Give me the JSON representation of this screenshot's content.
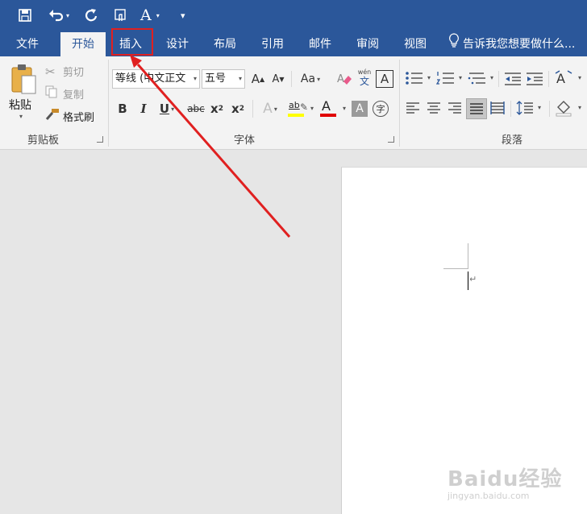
{
  "quick_access": {
    "save_icon": "save-icon",
    "undo_icon": "undo-icon",
    "redo_icon": "redo-icon",
    "touch_icon": "touch-mode-icon",
    "font_icon_label": "A",
    "customize_icon": "customize-qat-icon"
  },
  "tabs": {
    "file": "文件",
    "home": "开始",
    "insert": "插入",
    "design": "设计",
    "layout": "布局",
    "references": "引用",
    "mailings": "邮件",
    "review": "审阅",
    "view": "视图",
    "tell_me": "告诉我您想要做什么..."
  },
  "clipboard": {
    "paste": "粘贴",
    "cut": "剪切",
    "copy": "复制",
    "format_painter": "格式刷",
    "group_label": "剪贴板"
  },
  "font": {
    "font_name": "等线 (中文正文",
    "font_size": "五号",
    "grow": "A",
    "shrink": "A",
    "change_case": "Aa",
    "phonetic_top": "wén",
    "phonetic_bottom": "文",
    "char_border": "A",
    "bold": "B",
    "italic": "I",
    "underline": "U",
    "strike": "abc",
    "subscript_base": "x",
    "subscript": "2",
    "superscript_base": "x",
    "superscript": "2",
    "text_effects": "A",
    "highlight_label": "ab",
    "font_color": "A",
    "char_shading": "A",
    "enclose": "字",
    "group_label": "字体",
    "colors": {
      "highlight": "#ffff00",
      "font_color": "#e00000"
    }
  },
  "paragraph": {
    "group_label": "段落"
  },
  "document": {
    "paragraph_mark": "↵"
  },
  "watermark": {
    "brand": "Baidu经验",
    "url": "jingyan.baidu.com"
  },
  "colors": {
    "word_blue": "#2b579a",
    "annotation_red": "#e02020"
  }
}
